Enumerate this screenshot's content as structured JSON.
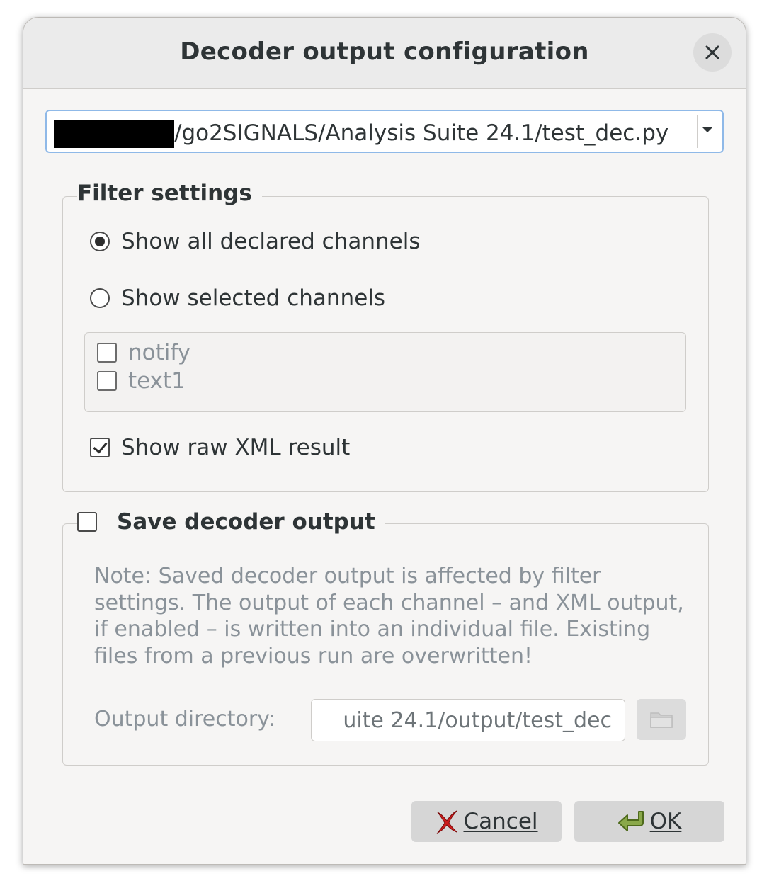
{
  "dialog": {
    "title": "Decoder output configuration"
  },
  "file_selector": {
    "value": "/go2SIGNALS/Analysis Suite 24.1/test_dec.py"
  },
  "filter_settings": {
    "legend": "Filter settings",
    "show_all_label": "Show all declared channels",
    "show_selected_label": "Show selected channels",
    "selected_mode": "all",
    "channels": [
      {
        "label": "notify",
        "checked": false
      },
      {
        "label": "text1",
        "checked": false
      }
    ],
    "show_raw_xml_label": "Show raw XML result",
    "show_raw_xml_checked": true
  },
  "save_output": {
    "legend": "Save decoder output",
    "checked": false,
    "note": "Note: Saved decoder output is affected by filter settings. The output of each channel – and XML output, if enabled – is written into an individual file. Existing files from a previous run are overwritten!",
    "dir_label": "Output directory:",
    "dir_value": "uite 24.1/output/test_dec"
  },
  "buttons": {
    "cancel_label": "Cancel",
    "ok_label": "OK"
  },
  "colors": {
    "accent_focus": "#8fb9e8",
    "cancel_icon": "#cc1b1b",
    "ok_icon": "#6f8c3a"
  }
}
